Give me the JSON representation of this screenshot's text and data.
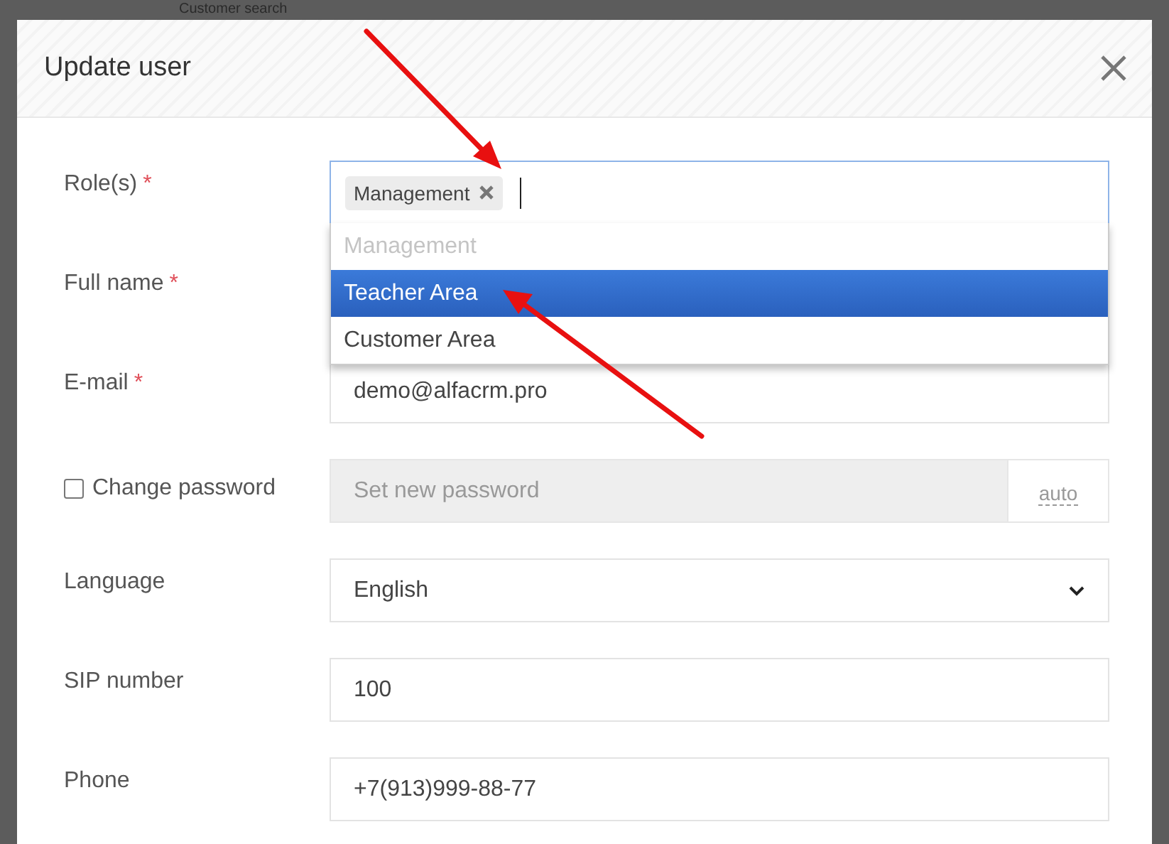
{
  "background": {
    "header_text": "Customer search"
  },
  "dialog": {
    "title": "Update user"
  },
  "fields": [
    {
      "kind": "tags",
      "label": "Role(s)",
      "mark": "*",
      "tags": [
        "Management"
      ],
      "options": [
        {
          "label": "Management",
          "disabled": true,
          "selected": false
        },
        {
          "label": "Teacher Area",
          "disabled": false,
          "selected": true
        },
        {
          "label": "Customer Area",
          "disabled": false,
          "selected": false
        }
      ]
    },
    {
      "kind": "covered",
      "label": "Full name",
      "mark": "*"
    },
    {
      "kind": "text",
      "label": "E-mail",
      "mark": "*",
      "value": "demo@alfacrm.pro"
    },
    {
      "kind": "password",
      "label": "Change password",
      "checked": false,
      "placeholder": "Set new password",
      "addon": "auto"
    },
    {
      "kind": "select",
      "label": "Language",
      "value": "English"
    },
    {
      "kind": "text",
      "label": "SIP number",
      "value": "100"
    },
    {
      "kind": "text",
      "label": "Phone",
      "value": "+7(913)999-88-77"
    }
  ]
}
